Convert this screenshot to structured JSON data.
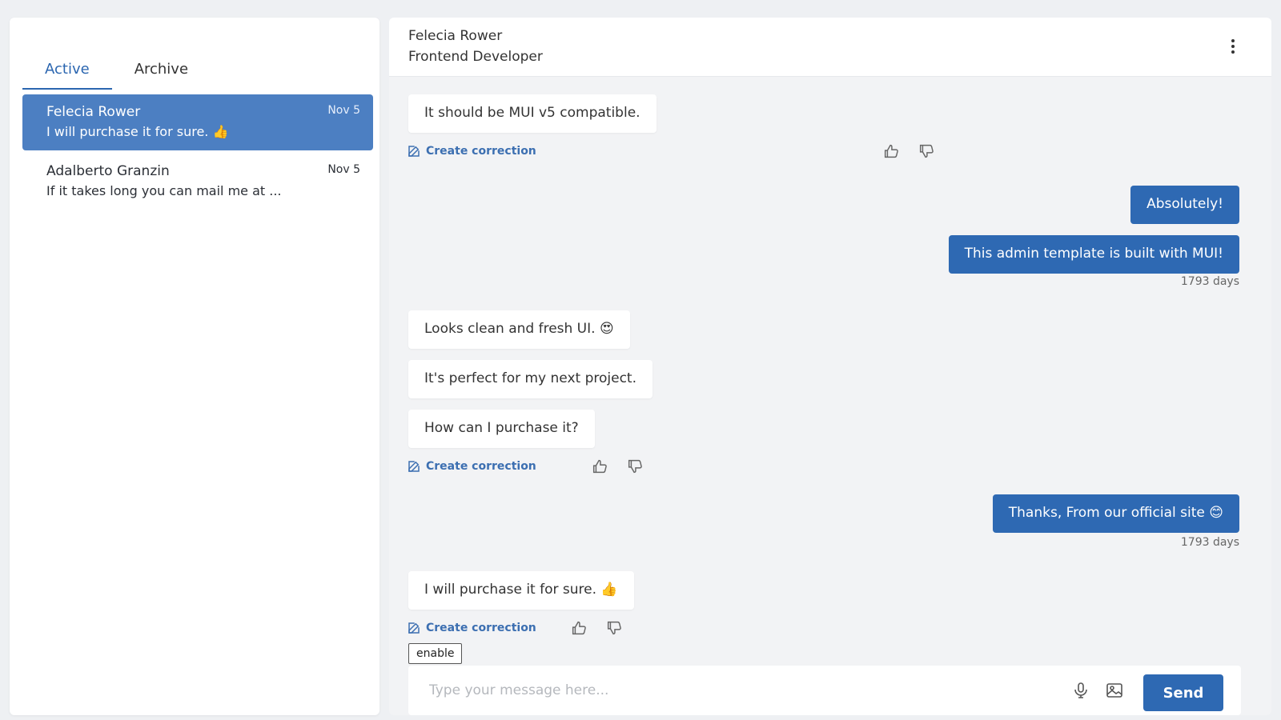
{
  "tabs": [
    {
      "label": "Active"
    },
    {
      "label": "Archive"
    }
  ],
  "conversations": [
    {
      "name": "Felecia Rower",
      "preview": "I will purchase it for sure. 👍",
      "date": "Nov 5"
    },
    {
      "name": "Adalberto Granzin",
      "preview": "If it takes long you can mail me at ...",
      "date": "Nov 5"
    }
  ],
  "chat": {
    "contact_name": "Felecia Rower",
    "contact_role": "Frontend Developer",
    "messages": [
      {
        "text": "It should be MUI v5 compatible."
      },
      {
        "text": "Absolutely!"
      },
      {
        "text": "This admin template is built with MUI!"
      },
      {
        "text": "Looks clean and fresh UI. 😍"
      },
      {
        "text": "It's perfect for my next project."
      },
      {
        "text": "How can I purchase it?"
      },
      {
        "text": "Thanks, From our official site 😊"
      },
      {
        "text": "I will purchase it for sure. 👍"
      }
    ],
    "times": [
      "1793 days",
      "1793 days"
    ],
    "correction_label": "Create correction",
    "enable_label": "enable"
  },
  "composer": {
    "placeholder": "Type your message here...",
    "send_label": "Send"
  },
  "colors": {
    "accent": "#2e69b3",
    "selected_conv": "#4c7fc2",
    "chat_bg": "#f2f3f5"
  }
}
